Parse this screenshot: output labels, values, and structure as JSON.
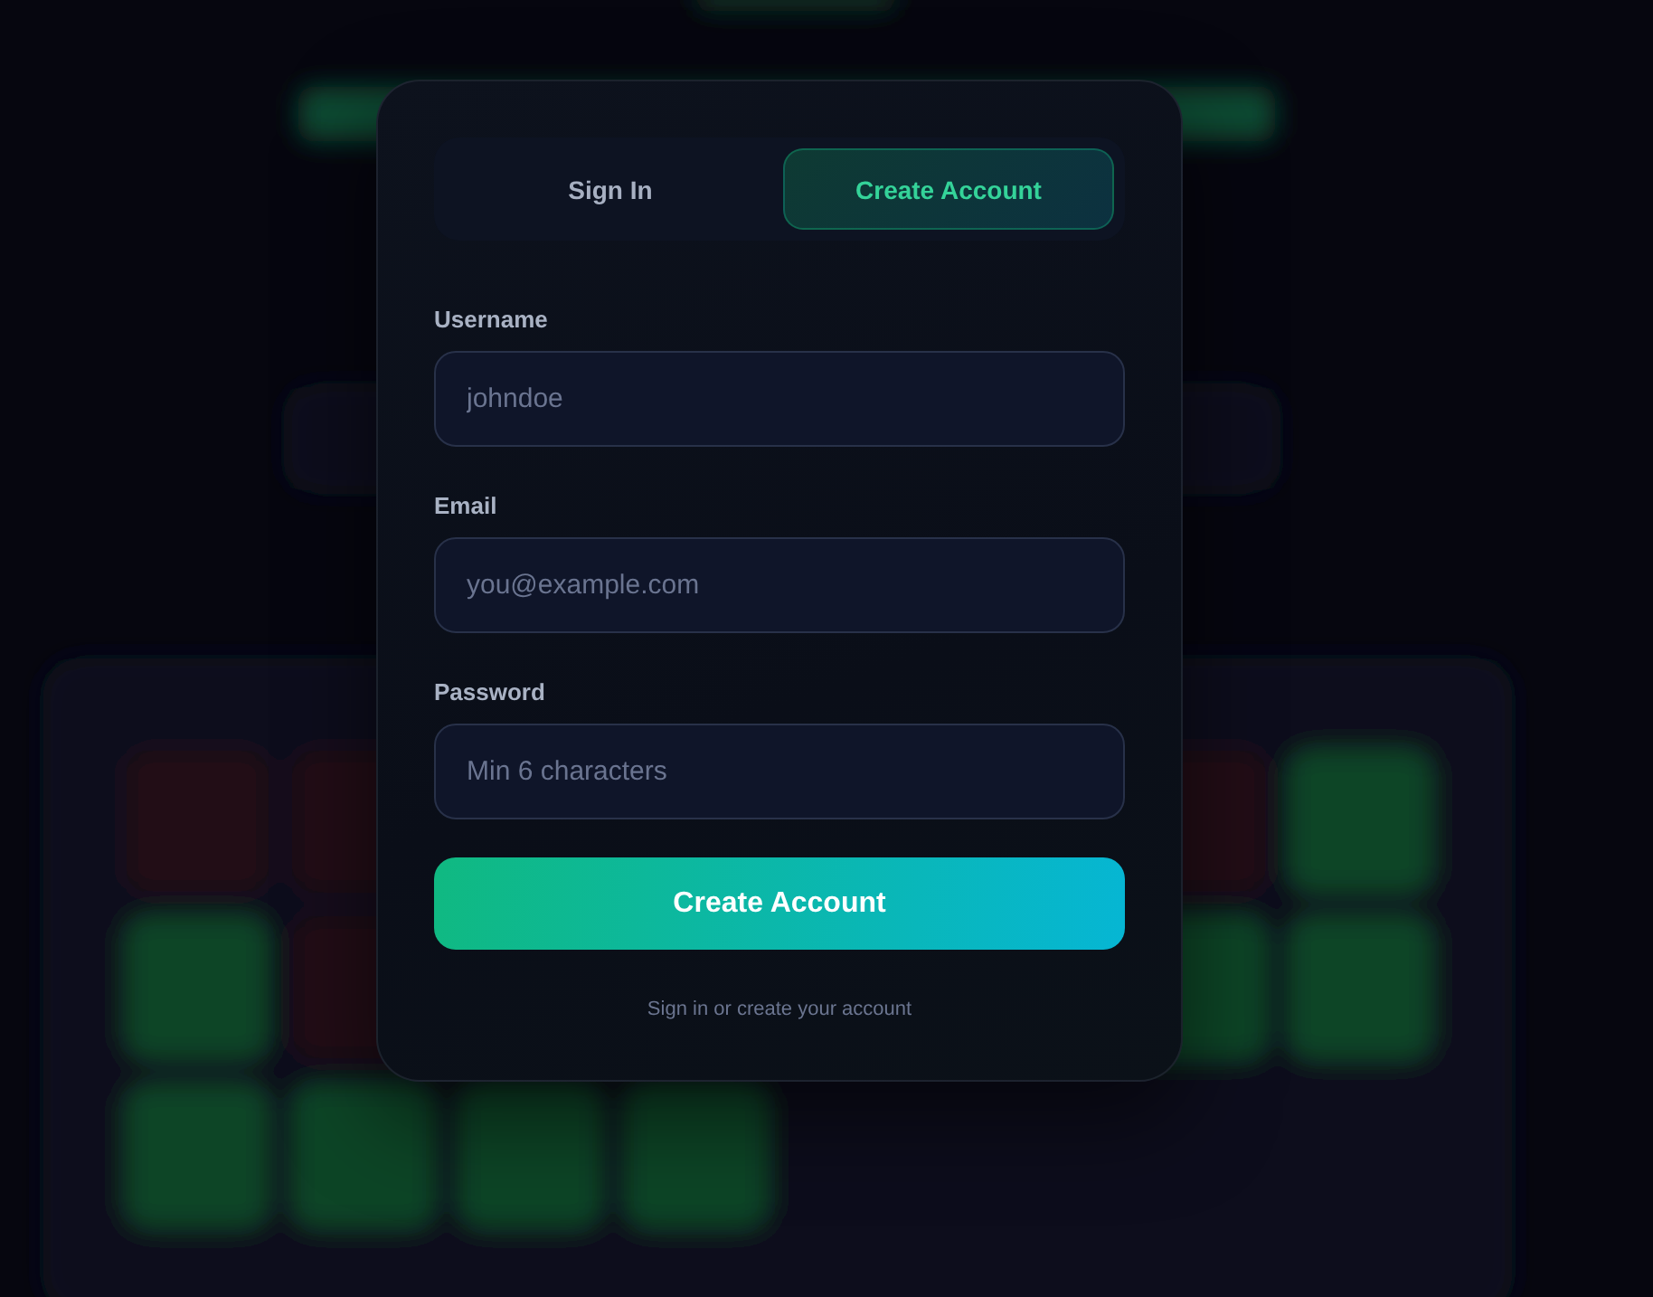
{
  "tabs": [
    {
      "label": "Sign In",
      "selected": false
    },
    {
      "label": "Create Account",
      "selected": true
    }
  ],
  "fields": [
    {
      "label": "Username",
      "placeholder": "johndoe"
    },
    {
      "label": "Email",
      "placeholder": "you@example.com"
    },
    {
      "label": "Password",
      "placeholder": "Min 6 characters"
    }
  ],
  "submit_button": {
    "label": "Create Account"
  },
  "footer_note": "Sign in or create your account"
}
